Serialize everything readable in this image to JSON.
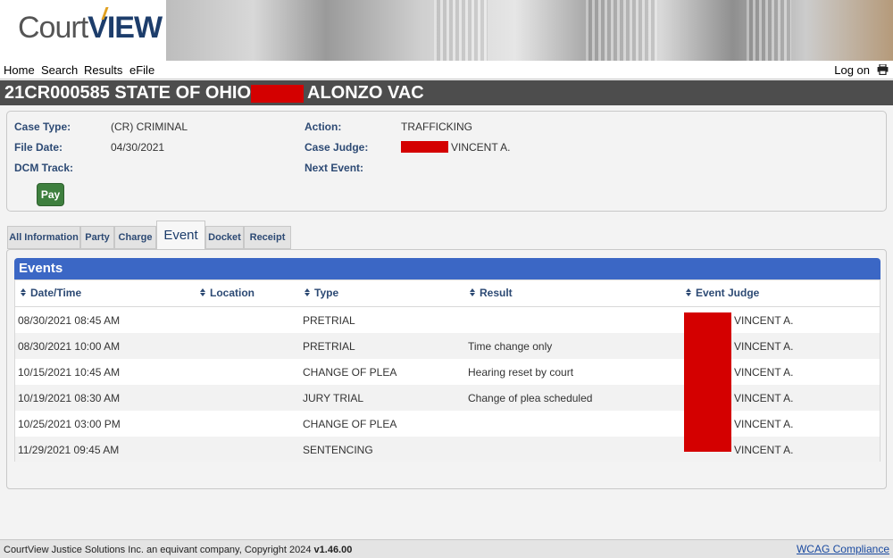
{
  "brand": {
    "logo_court": "Court",
    "logo_view": "VIEW"
  },
  "nav": {
    "home": "Home",
    "search": "Search",
    "results": "Results",
    "efile": "eFile",
    "logon": "Log on"
  },
  "case": {
    "title_prefix": "21CR000585 STATE OF OHIO vs.",
    "title_suffix": "ALONZO VAC",
    "labels": {
      "case_type": "Case Type:",
      "file_date": "File Date:",
      "dcm_track": "DCM Track:",
      "action": "Action:",
      "case_judge": "Case Judge:",
      "next_event": "Next Event:"
    },
    "case_type": "(CR) CRIMINAL",
    "file_date": "04/30/2021",
    "dcm_track": "",
    "action": "TRAFFICKING",
    "case_judge": "VINCENT A.",
    "next_event": "",
    "pay_label": "Pay"
  },
  "tabs": [
    {
      "label": "All Information",
      "active": false
    },
    {
      "label": "Party",
      "active": false
    },
    {
      "label": "Charge",
      "active": false
    },
    {
      "label": "Event",
      "active": true
    },
    {
      "label": "Docket",
      "active": false
    },
    {
      "label": "Receipt",
      "active": false
    }
  ],
  "events": {
    "title": "Events",
    "columns": [
      "Date/Time",
      "Location",
      "Type",
      "Result",
      "Event Judge"
    ],
    "rows": [
      {
        "datetime": "08/30/2021 08:45 AM",
        "location": "",
        "type": "PRETRIAL",
        "result": "",
        "judge": "VINCENT A."
      },
      {
        "datetime": "08/30/2021 10:00 AM",
        "location": "",
        "type": "PRETRIAL",
        "result": "Time change only",
        "judge": "VINCENT A."
      },
      {
        "datetime": "10/15/2021 10:45 AM",
        "location": "",
        "type": "CHANGE OF PLEA",
        "result": "Hearing reset by court",
        "judge": "VINCENT A."
      },
      {
        "datetime": "10/19/2021 08:30 AM",
        "location": "",
        "type": "JURY TRIAL",
        "result": "Change of plea scheduled",
        "judge": "VINCENT A."
      },
      {
        "datetime": "10/25/2021 03:00 PM",
        "location": "",
        "type": "CHANGE OF PLEA",
        "result": "",
        "judge": "VINCENT A."
      },
      {
        "datetime": "11/29/2021 09:45 AM",
        "location": "",
        "type": "SENTENCING",
        "result": "",
        "judge": "VINCENT A."
      }
    ]
  },
  "footer": {
    "copyright": "CourtView Justice Solutions Inc. an equivant company, Copyright 2024",
    "version": "v1.46.00",
    "wcag": "WCAG Compliance"
  },
  "colors": {
    "header_blue": "#3b67c5",
    "label_blue": "#2d4a74",
    "title_bar": "#4d4d4d",
    "pay_green": "#3e7f3e",
    "redaction": "#d40000"
  }
}
